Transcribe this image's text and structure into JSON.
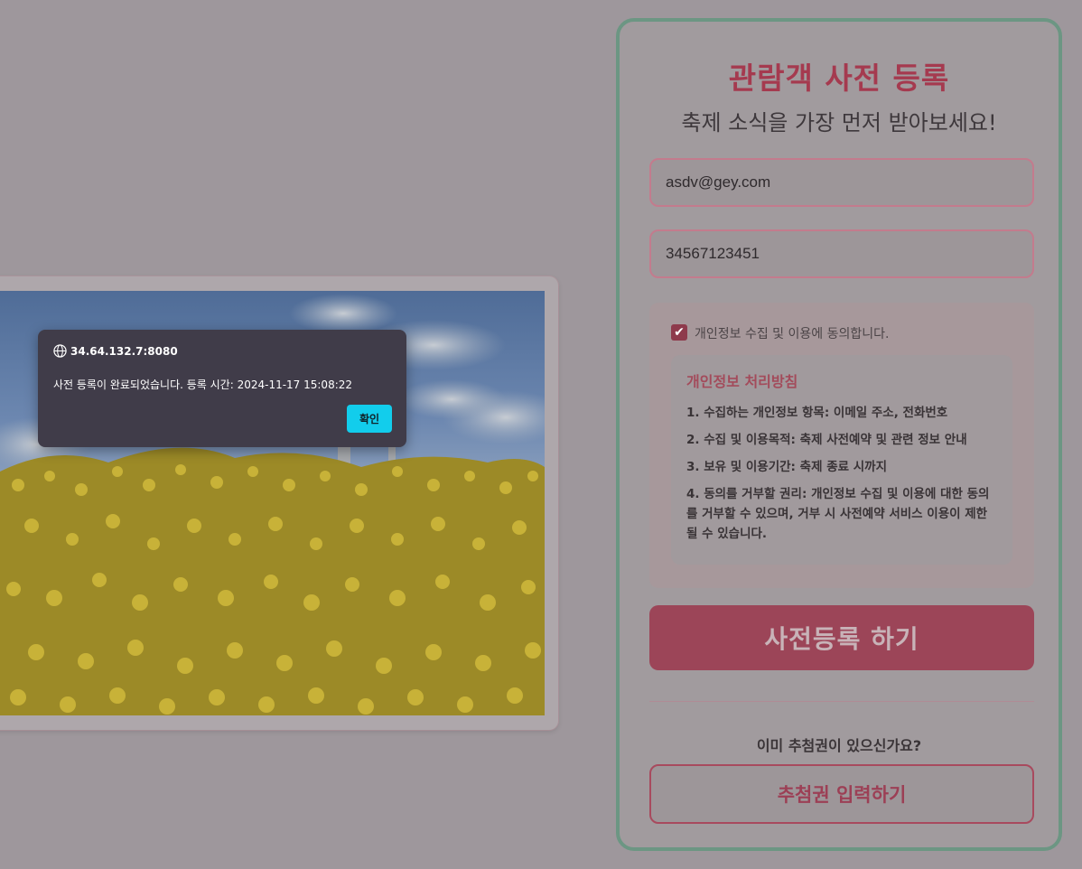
{
  "form": {
    "title": "관람객 사전 등록",
    "subtitle": "축제 소식을 가장 먼저 받아보세요!",
    "email_value": "asdv@gey.com",
    "phone_value": "34567123451",
    "consent_label": "개인정보 수집 및 이용에 동의합니다.",
    "consent_checked": true,
    "policy": {
      "title": "개인정보 처리방침",
      "items": [
        "1. 수집하는 개인정보 항목: 이메일 주소, 전화번호",
        "2. 수집 및 이용목적: 축제 사전예약 및 관련 정보 안내",
        "3. 보유 및 이용기간: 축제 종료 시까지",
        "4. 동의를 거부할 권리: 개인정보 수집 및 이용에 대한 동의를 거부할 수 있으며, 거부 시 사전예약 서비스 이용이 제한될 수 있습니다."
      ]
    },
    "submit_label": "사전등록 하기",
    "question": "이미 추첨권이 있으신가요?",
    "ticket_label": "추첨권 입력하기"
  },
  "dialog": {
    "origin": "34.64.132.7:8080",
    "message": "사전 등록이 완료되었습니다. 등록 시간: 2024-11-17 15:08:22",
    "ok_label": "확인"
  },
  "colors": {
    "accent": "#a53a4f",
    "panel_border": "#6c9683",
    "dialog_button": "#12cdec"
  }
}
